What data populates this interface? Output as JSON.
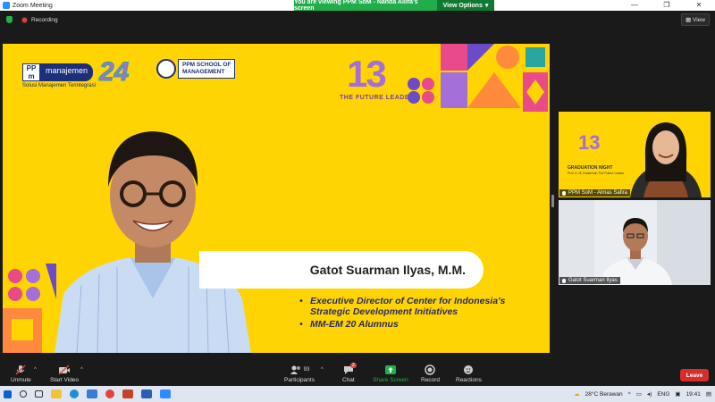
{
  "window": {
    "title": "Zoom Meeting",
    "controls": [
      "—",
      "❐",
      "✕"
    ]
  },
  "share_banner": {
    "message": "You are viewing PPM SoM - Nanda Allifa's screen",
    "view_options": "View Options"
  },
  "topbar": {
    "recording": "Recording",
    "view": "View"
  },
  "slide": {
    "logo_ppm_box": "PP m",
    "logo_ppm_name": "manajemen",
    "logo_ppm_tagline": "Solusi Manajemen Terintegrasi",
    "logo_anniv": "24",
    "logo_school_l1": "PPM SCHOOL OF",
    "logo_school_l2": "MANAGEMENT",
    "logo_number": "13",
    "logo_subtitle": "THE FUTURE LEADER",
    "speaker_name": "Gatot Suarman Ilyas, M.M.",
    "bullets": [
      "Executive Director of Center for Indonesia's Strategic Development Initiatives",
      "MM-EM 20 Alumnus"
    ]
  },
  "thumbnails": [
    {
      "label": "PPM SoM - Almas Safira",
      "slide_number": "13",
      "slide_heading": "GRADUATION NIGHT",
      "slide_small": "Prof. A. M. Kadarman\nThe Future Leader"
    },
    {
      "label": "Gatot Suarman Ilyas"
    }
  ],
  "toolbar": {
    "unmute": "Unmute",
    "start_video": "Start Video",
    "participants": "Participants",
    "participants_count": "93",
    "chat": "Chat",
    "chat_badge": "2",
    "share_screen": "Share Screen",
    "record": "Record",
    "reactions": "Reactions",
    "leave": "Leave"
  },
  "taskbar": {
    "weather": "28°C  Berawan",
    "lang": "ENG",
    "time": "19:41"
  },
  "colors": {
    "slide_yellow": "#ffd400",
    "share_green": "#1fae4a",
    "leave_red": "#d62e2e",
    "accent_purple": "#a46fd8"
  }
}
